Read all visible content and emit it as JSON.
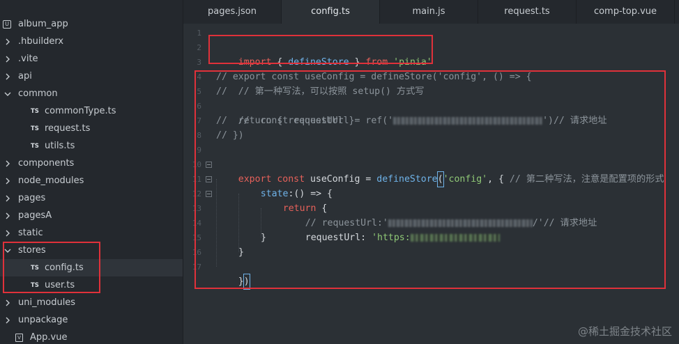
{
  "sidebar": {
    "root": {
      "label": "album_app",
      "badge": "U"
    },
    "items": [
      {
        "label": ".hbuilderx",
        "kind": "folder",
        "expanded": false
      },
      {
        "label": ".vite",
        "kind": "folder",
        "expanded": false
      },
      {
        "label": "api",
        "kind": "folder",
        "expanded": false
      },
      {
        "label": "common",
        "kind": "folder",
        "expanded": true
      },
      {
        "label": "commonType.ts",
        "kind": "ts",
        "badge": "TS"
      },
      {
        "label": "request.ts",
        "kind": "ts",
        "badge": "TS"
      },
      {
        "label": "utils.ts",
        "kind": "ts",
        "badge": "TS"
      },
      {
        "label": "components",
        "kind": "folder",
        "expanded": false
      },
      {
        "label": "node_modules",
        "kind": "folder",
        "expanded": false
      },
      {
        "label": "pages",
        "kind": "folder",
        "expanded": false
      },
      {
        "label": "pagesA",
        "kind": "folder",
        "expanded": false
      },
      {
        "label": "static",
        "kind": "folder",
        "expanded": false
      },
      {
        "label": "stores",
        "kind": "folder",
        "expanded": true
      },
      {
        "label": "config.ts",
        "kind": "ts",
        "badge": "TS",
        "selected": true
      },
      {
        "label": "user.ts",
        "kind": "ts",
        "badge": "TS"
      },
      {
        "label": "uni_modules",
        "kind": "folder",
        "expanded": false
      },
      {
        "label": "unpackage",
        "kind": "folder",
        "expanded": false
      },
      {
        "label": "App.vue",
        "kind": "vue",
        "badge": "V"
      }
    ]
  },
  "tabs": [
    {
      "label": "pages.json",
      "active": false
    },
    {
      "label": "config.ts",
      "active": true
    },
    {
      "label": "main.js",
      "active": false
    },
    {
      "label": "request.ts",
      "active": false
    },
    {
      "label": "comp-top.vue",
      "active": false
    }
  ],
  "editor": {
    "line_numbers": [
      "1",
      "2",
      "3",
      "4",
      "5",
      "6",
      "7",
      "8",
      "9",
      "10",
      "11",
      "12",
      "13",
      "14",
      "15",
      "16",
      "17"
    ],
    "code": {
      "l2_import": "import",
      "l2_mid": " { ",
      "l2_fn": "defineStore",
      "l2_close": " } ",
      "l2_from": "from",
      "l2_space": " ",
      "l2_str": "'pinia'",
      "l4": "// export const useConfig = defineStore('config', () => {",
      "l5": "//  // 第一种写法，可以按照 setup() 方式写",
      "l6_a": "//  const requestUrl = ref('",
      "l6_b": "')// 请求地址",
      "l7": "//  return { requestUrl }",
      "l8": "// })",
      "l10_export": "export",
      "l10_const": " const ",
      "l10_name": "useConfig",
      "l10_eq": " = ",
      "l10_fn": "defineStore",
      "l10_paren": "(",
      "l10_str": "'config'",
      "l10_rest": ", { ",
      "l10_cm": "// 第二种写法，注意是配置项的形式",
      "l11_fn": "state",
      "l11_rest": ":() => {",
      "l12_kw": "return",
      "l12_rest": " {",
      "l13_a": "// requestUrl:'",
      "l13_b": "/'// 请求地址",
      "l14_key": "requestUrl",
      "l14_colon": ": ",
      "l14_str": "'https:",
      "l15": "}",
      "l16": "}",
      "l17_a": "}",
      "l17_b": ")"
    }
  },
  "watermark": "@稀土掘金技术社区",
  "colors": {
    "keyword": "#e7615a",
    "function": "#6fb3e9",
    "string": "#8fc876",
    "comment": "#8c949b",
    "highlight_box": "#e0313a"
  }
}
